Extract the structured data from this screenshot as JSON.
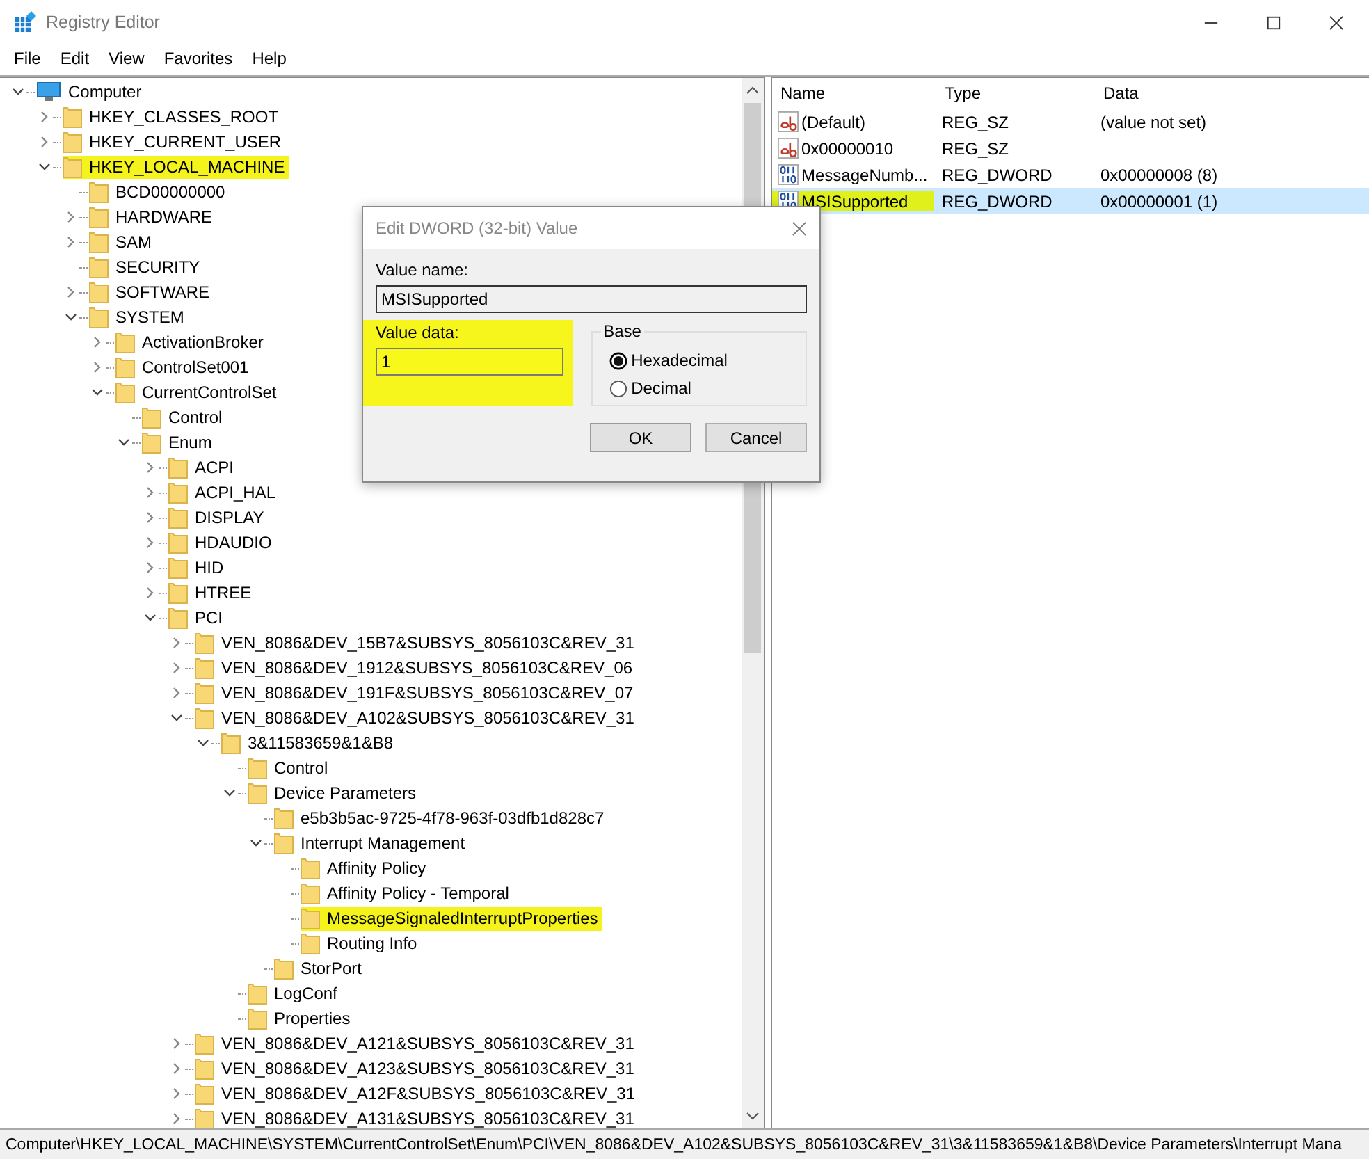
{
  "window": {
    "title": "Registry Editor"
  },
  "menu": [
    "File",
    "Edit",
    "View",
    "Favorites",
    "Help"
  ],
  "tree": [
    {
      "label": "Computer",
      "kind": "computer",
      "expanded": true,
      "children": [
        {
          "label": "HKEY_CLASSES_ROOT",
          "expanded": false
        },
        {
          "label": "HKEY_CURRENT_USER",
          "expanded": false
        },
        {
          "label": "HKEY_LOCAL_MACHINE",
          "expanded": true,
          "highlighted": true,
          "children": [
            {
              "label": "BCD00000000"
            },
            {
              "label": "HARDWARE",
              "expanded": false
            },
            {
              "label": "SAM",
              "expanded": false
            },
            {
              "label": "SECURITY"
            },
            {
              "label": "SOFTWARE",
              "expanded": false
            },
            {
              "label": "SYSTEM",
              "expanded": true,
              "children": [
                {
                  "label": "ActivationBroker",
                  "expanded": false
                },
                {
                  "label": "ControlSet001",
                  "expanded": false
                },
                {
                  "label": "CurrentControlSet",
                  "expanded": true,
                  "children": [
                    {
                      "label": "Control"
                    },
                    {
                      "label": "Enum",
                      "expanded": true,
                      "children": [
                        {
                          "label": "ACPI",
                          "expanded": false
                        },
                        {
                          "label": "ACPI_HAL",
                          "expanded": false
                        },
                        {
                          "label": "DISPLAY",
                          "expanded": false
                        },
                        {
                          "label": "HDAUDIO",
                          "expanded": false
                        },
                        {
                          "label": "HID",
                          "expanded": false
                        },
                        {
                          "label": "HTREE",
                          "expanded": false
                        },
                        {
                          "label": "PCI",
                          "expanded": true,
                          "children": [
                            {
                              "label": "VEN_8086&DEV_15B7&SUBSYS_8056103C&REV_31",
                              "expanded": false
                            },
                            {
                              "label": "VEN_8086&DEV_1912&SUBSYS_8056103C&REV_06",
                              "expanded": false
                            },
                            {
                              "label": "VEN_8086&DEV_191F&SUBSYS_8056103C&REV_07",
                              "expanded": false
                            },
                            {
                              "label": "VEN_8086&DEV_A102&SUBSYS_8056103C&REV_31",
                              "expanded": true,
                              "children": [
                                {
                                  "label": "3&11583659&1&B8",
                                  "expanded": true,
                                  "children": [
                                    {
                                      "label": "Control"
                                    },
                                    {
                                      "label": "Device Parameters",
                                      "expanded": true,
                                      "children": [
                                        {
                                          "label": "e5b3b5ac-9725-4f78-963f-03dfb1d828c7"
                                        },
                                        {
                                          "label": "Interrupt Management",
                                          "expanded": true,
                                          "children": [
                                            {
                                              "label": "Affinity Policy"
                                            },
                                            {
                                              "label": "Affinity Policy - Temporal"
                                            },
                                            {
                                              "label": "MessageSignaledInterruptProperties",
                                              "highlighted": true
                                            },
                                            {
                                              "label": "Routing Info"
                                            }
                                          ]
                                        },
                                        {
                                          "label": "StorPort"
                                        }
                                      ]
                                    },
                                    {
                                      "label": "LogConf"
                                    },
                                    {
                                      "label": "Properties"
                                    }
                                  ]
                                }
                              ]
                            },
                            {
                              "label": "VEN_8086&DEV_A121&SUBSYS_8056103C&REV_31",
                              "expanded": false
                            },
                            {
                              "label": "VEN_8086&DEV_A123&SUBSYS_8056103C&REV_31",
                              "expanded": false
                            },
                            {
                              "label": "VEN_8086&DEV_A12F&SUBSYS_8056103C&REV_31",
                              "expanded": false
                            },
                            {
                              "label": "VEN_8086&DEV_A131&SUBSYS_8056103C&REV_31",
                              "expanded": false
                            }
                          ]
                        }
                      ]
                    }
                  ]
                }
              ]
            }
          ]
        }
      ]
    }
  ],
  "values": {
    "columns": [
      "Name",
      "Type",
      "Data"
    ],
    "rows": [
      {
        "kind": "string",
        "name": "(Default)",
        "type": "REG_SZ",
        "data": "(value not set)",
        "selected": false
      },
      {
        "kind": "string",
        "name": "0x00000010",
        "type": "REG_SZ",
        "selected": false
      },
      {
        "kind": "binary",
        "name": "MessageNumb...",
        "type": "REG_DWORD",
        "data": "0x00000008 (8)",
        "selected": false
      },
      {
        "kind": "binary",
        "name": "MSISupported",
        "type": "REG_DWORD",
        "data": "0x00000001 (1)",
        "selected": true,
        "highlighted": true
      }
    ]
  },
  "dialog": {
    "title": "Edit DWORD (32-bit) Value",
    "value_name_label": "Value name:",
    "value_name": "MSISupported",
    "value_data_label": "Value data:",
    "value_data": "1",
    "highlighted": true,
    "base_label": "Base",
    "base_options": [
      {
        "label": "Hexadecimal",
        "selected": true
      },
      {
        "label": "Decimal",
        "selected": false
      }
    ],
    "buttons": [
      "OK",
      "Cancel"
    ]
  },
  "status_bar": "Computer\\HKEY_LOCAL_MACHINE\\SYSTEM\\CurrentControlSet\\Enum\\PCI\\VEN_8086&DEV_A102&SUBSYS_8056103C&REV_31\\3&11583659&1&B8\\Device Parameters\\Interrupt Mana"
}
